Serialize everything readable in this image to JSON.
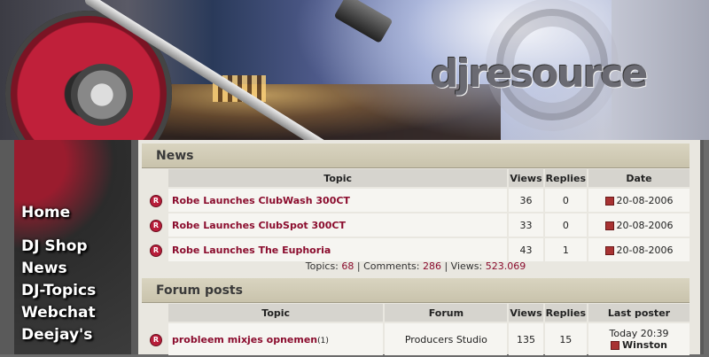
{
  "brand": {
    "logo_text": "djresource"
  },
  "nav": {
    "items": [
      "Home",
      "DJ Shop",
      "News",
      "DJ-Topics",
      "Webchat",
      "Deejay's"
    ]
  },
  "news": {
    "title": "News",
    "columns": [
      "Topic",
      "Views",
      "Replies",
      "Date"
    ],
    "rows": [
      {
        "topic": "Robe Launches ClubWash 300CT",
        "views": "36",
        "replies": "0",
        "date": "20-08-2006"
      },
      {
        "topic": "Robe Launches ClubSpot 300CT",
        "views": "33",
        "replies": "0",
        "date": "20-08-2006"
      },
      {
        "topic": "Robe Launches The Euphoria",
        "views": "43",
        "replies": "1",
        "date": "20-08-2006"
      }
    ],
    "stats": {
      "topics_label": "Topics:",
      "topics": "68",
      "comments_label": "Comments:",
      "comments": "286",
      "views_label": "Views:",
      "views": "523.069"
    }
  },
  "forum": {
    "title": "Forum posts",
    "columns": [
      "Topic",
      "Forum",
      "Views",
      "Replies",
      "Last poster"
    ],
    "rows": [
      {
        "topic": "probleem mixjes opnemen",
        "pages": "(1)",
        "forum": "Producers Studio",
        "views": "135",
        "replies": "15",
        "time": "Today 20:39",
        "poster": "Winston"
      }
    ]
  },
  "colors": {
    "accent": "#8b0d2e",
    "header_bar": "#d9d4c0",
    "cell_bg": "#f6f5f1"
  }
}
